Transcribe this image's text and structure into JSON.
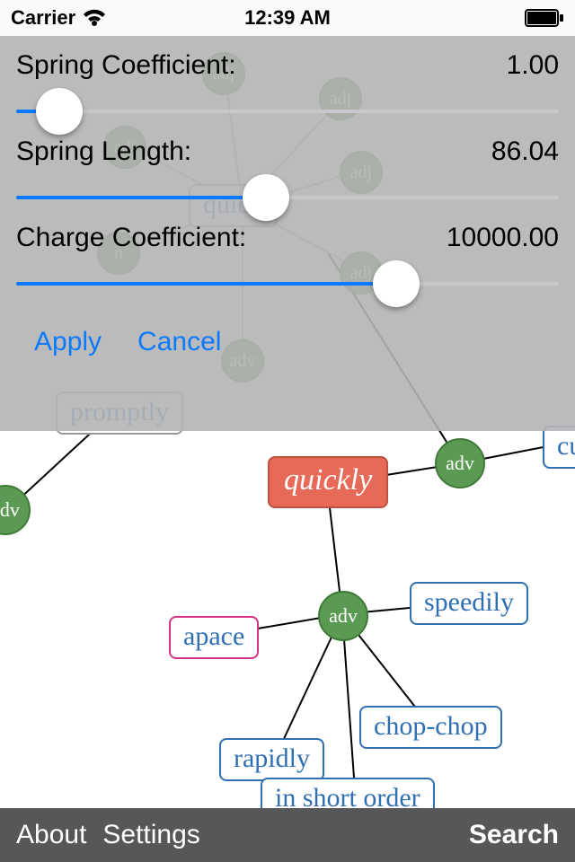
{
  "status": {
    "carrier": "Carrier",
    "time": "12:39 AM"
  },
  "panel": {
    "sliders": [
      {
        "label": "Spring Coefficient:",
        "value": "1.00",
        "fill_pct": 8
      },
      {
        "label": "Spring Length:",
        "value": "86.04",
        "fill_pct": 46
      },
      {
        "label": "Charge Coefficient:",
        "value": "10000.00",
        "fill_pct": 70
      }
    ],
    "apply": "Apply",
    "cancel": "Cancel"
  },
  "graph": {
    "center_word": "quickly",
    "adv_label": "adv",
    "words": {
      "promptly": "promptly",
      "speedily": "speedily",
      "apace": "apace",
      "chop_chop": "chop-chop",
      "rapidly": "rapidly",
      "in_short_order": "in short order",
      "cu": "cu"
    }
  },
  "toolbar": {
    "about": "About",
    "settings": "Settings",
    "search": "Search"
  }
}
